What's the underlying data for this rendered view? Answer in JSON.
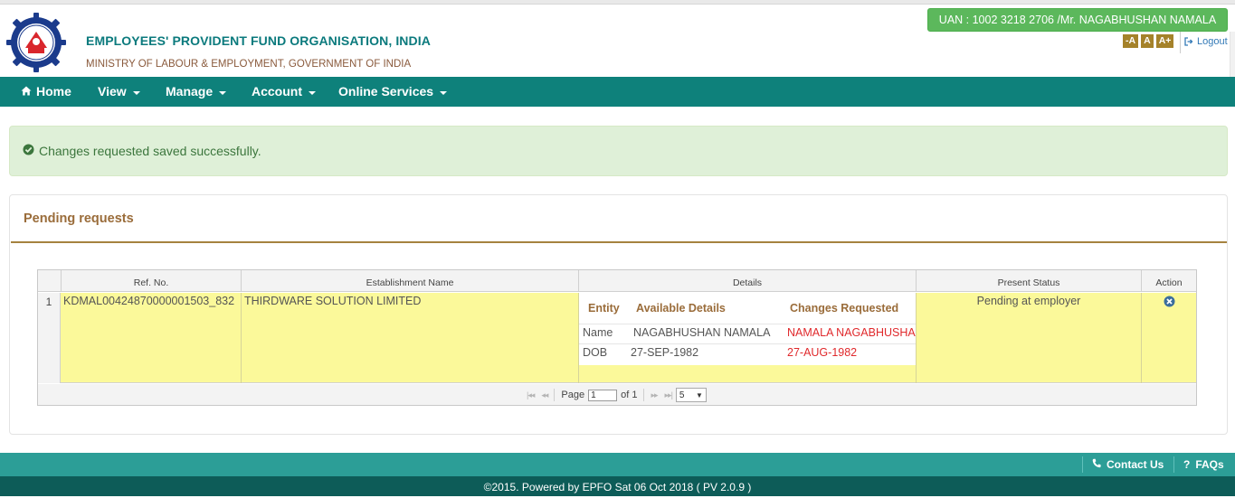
{
  "header": {
    "org_name": "EMPLOYEES' PROVIDENT FUND ORGANISATION, INDIA",
    "ministry": "MINISTRY OF LABOUR & EMPLOYMENT, GOVERNMENT OF INDIA",
    "uan_badge": "UAN : 1002 3218 2706 /Mr. NAGABHUSHAN NAMALA",
    "font_decrease": "-A",
    "font_normal": "A",
    "font_increase": "A+",
    "logout": "Logout",
    "logo_icon": "epfo-emblem-icon"
  },
  "nav": {
    "home": "Home",
    "view": "View",
    "manage": "Manage",
    "account": "Account",
    "online_services": "Online Services"
  },
  "alert": {
    "message": "Changes requested saved successfully."
  },
  "panel": {
    "title": "Pending requests"
  },
  "grid": {
    "headers": {
      "ref_no": "Ref. No.",
      "establishment": "Establishment Name",
      "details": "Details",
      "status": "Present Status",
      "action": "Action"
    },
    "rows": [
      {
        "num": "1",
        "ref_no": "KDMAL00424870000001503_832",
        "establishment": "THIRDWARE SOLUTION LIMITED",
        "details": {
          "head_entity": "Entity",
          "head_available": "Available Details",
          "head_changes": "Changes Requested",
          "name_label": "Name",
          "name_available": "NAGABHUSHAN NAMALA",
          "name_changes": "NAMALA NAGABHUSHAN",
          "dob_label": "DOB",
          "dob_available": "27-SEP-1982",
          "dob_changes": "27-AUG-1982"
        },
        "status": "Pending at employer"
      }
    ],
    "pager": {
      "page_label": "Page",
      "page_value": "1",
      "of_label": "of 1",
      "page_size": "5"
    }
  },
  "footer": {
    "contact": "Contact Us",
    "faqs": "FAQs",
    "copyright": "©2015. Powered by EPFO Sat 06 Oct 2018 ( PV 2.0.9 )"
  },
  "colors": {
    "brand_teal": "#0e817b",
    "header_text": "#0b7a7d",
    "accent_brown": "#a5822a",
    "row_highlight": "#fbf99a",
    "changed_value": "#e0292c"
  }
}
